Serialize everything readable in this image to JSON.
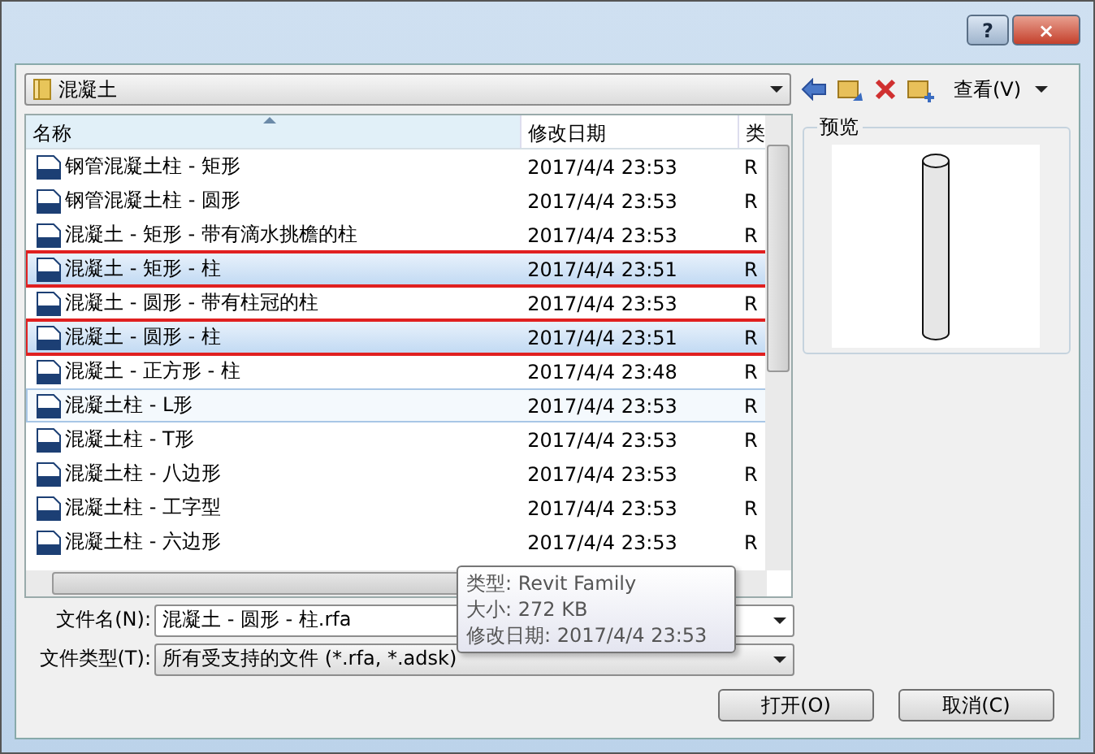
{
  "window": {
    "help_button": "?",
    "close_button": "×"
  },
  "location": {
    "value": "混凝土"
  },
  "toolbar": {
    "view_label": "查看(V)"
  },
  "file_list": {
    "columns": [
      "名称",
      "修改日期",
      "类"
    ],
    "rows": [
      {
        "name": "钢管混凝土柱 - 矩形",
        "date": "2017/4/4 23:53",
        "type": "R",
        "selected": false,
        "hovered": false,
        "annotated": false
      },
      {
        "name": "钢管混凝土柱 - 圆形",
        "date": "2017/4/4 23:53",
        "type": "R",
        "selected": false,
        "hovered": false,
        "annotated": false
      },
      {
        "name": "混凝土 - 矩形 - 带有滴水挑檐的柱",
        "date": "2017/4/4 23:53",
        "type": "R",
        "selected": false,
        "hovered": false,
        "annotated": false
      },
      {
        "name": "混凝土 - 矩形 - 柱",
        "date": "2017/4/4 23:51",
        "type": "R",
        "selected": true,
        "hovered": false,
        "annotated": true
      },
      {
        "name": "混凝土 - 圆形 - 带有柱冠的柱",
        "date": "2017/4/4 23:53",
        "type": "R",
        "selected": false,
        "hovered": false,
        "annotated": false
      },
      {
        "name": "混凝土 - 圆形 - 柱",
        "date": "2017/4/4 23:51",
        "type": "R",
        "selected": true,
        "hovered": false,
        "annotated": true
      },
      {
        "name": "混凝土 - 正方形 - 柱",
        "date": "2017/4/4 23:48",
        "type": "R",
        "selected": false,
        "hovered": false,
        "annotated": false
      },
      {
        "name": "混凝土柱 - L形",
        "date": "2017/4/4 23:53",
        "type": "R",
        "selected": false,
        "hovered": true,
        "annotated": false
      },
      {
        "name": "混凝土柱 - T形",
        "date": "2017/4/4 23:53",
        "type": "R",
        "selected": false,
        "hovered": false,
        "annotated": false
      },
      {
        "name": "混凝土柱 - 八边形",
        "date": "2017/4/4 23:53",
        "type": "R",
        "selected": false,
        "hovered": false,
        "annotated": false
      },
      {
        "name": "混凝土柱 - 工字型",
        "date": "2017/4/4 23:53",
        "type": "R",
        "selected": false,
        "hovered": false,
        "annotated": false
      },
      {
        "name": "混凝土柱 - 六边形",
        "date": "2017/4/4 23:53",
        "type": "R",
        "selected": false,
        "hovered": false,
        "annotated": false
      }
    ]
  },
  "tooltip": {
    "lines": [
      "类型: Revit Family",
      "大小: 272 KB",
      "修改日期: 2017/4/4 23:53"
    ]
  },
  "preview": {
    "title": "预览"
  },
  "file_name": {
    "label": "文件名(N):",
    "value": "混凝土 - 圆形 - 柱.rfa"
  },
  "file_type": {
    "label": "文件类型(T):",
    "value": "所有受支持的文件 (*.rfa, *.adsk)"
  },
  "buttons": [
    "打开(O)",
    "取消(C)"
  ]
}
